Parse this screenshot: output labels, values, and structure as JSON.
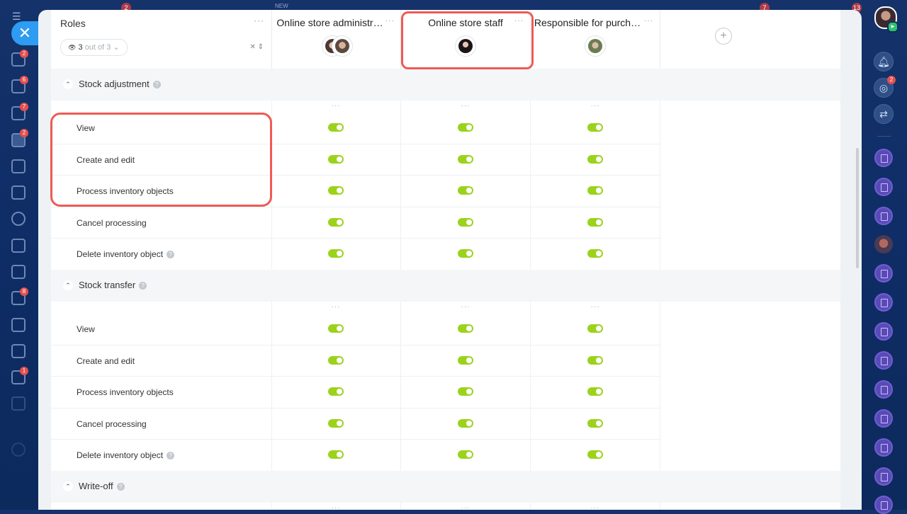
{
  "topbar": {
    "new_label": "NEW",
    "badges": [
      "2",
      "7",
      "13"
    ]
  },
  "left_sidebar": {
    "close_glyph": "✕",
    "badges": [
      "2",
      "6",
      "7",
      "2",
      "8",
      "1"
    ]
  },
  "right_sidebar": {
    "notification_badge": "2"
  },
  "roles_header": {
    "title": "Roles",
    "more": "···",
    "counter_value": "3",
    "counter_suffix": "out of 3"
  },
  "columns": [
    {
      "title": "Online store administr…"
    },
    {
      "title": "Online store staff"
    },
    {
      "title": "Responsible for purch…"
    }
  ],
  "sections": [
    {
      "title": "Stock adjustment",
      "rows": [
        {
          "label": "View",
          "toggles": [
            true,
            true,
            true
          ]
        },
        {
          "label": "Create and edit",
          "toggles": [
            true,
            true,
            true
          ]
        },
        {
          "label": "Process inventory objects",
          "toggles": [
            true,
            true,
            true
          ]
        },
        {
          "label": "Cancel processing",
          "toggles": [
            true,
            true,
            true
          ]
        },
        {
          "label": "Delete inventory object",
          "toggles": [
            true,
            true,
            true
          ]
        }
      ]
    },
    {
      "title": "Stock transfer",
      "rows": [
        {
          "label": "View",
          "toggles": [
            true,
            true,
            true
          ]
        },
        {
          "label": "Create and edit",
          "toggles": [
            true,
            true,
            true
          ]
        },
        {
          "label": "Process inventory objects",
          "toggles": [
            true,
            true,
            true
          ]
        },
        {
          "label": "Cancel processing",
          "toggles": [
            true,
            true,
            true
          ]
        },
        {
          "label": "Delete inventory object",
          "toggles": [
            true,
            true,
            true
          ]
        }
      ]
    },
    {
      "title": "Write-off",
      "rows": []
    }
  ],
  "colors": {
    "toggle_on": "#9bd31c",
    "highlight": "#ef5a55",
    "accent": "#2e9cf2"
  }
}
